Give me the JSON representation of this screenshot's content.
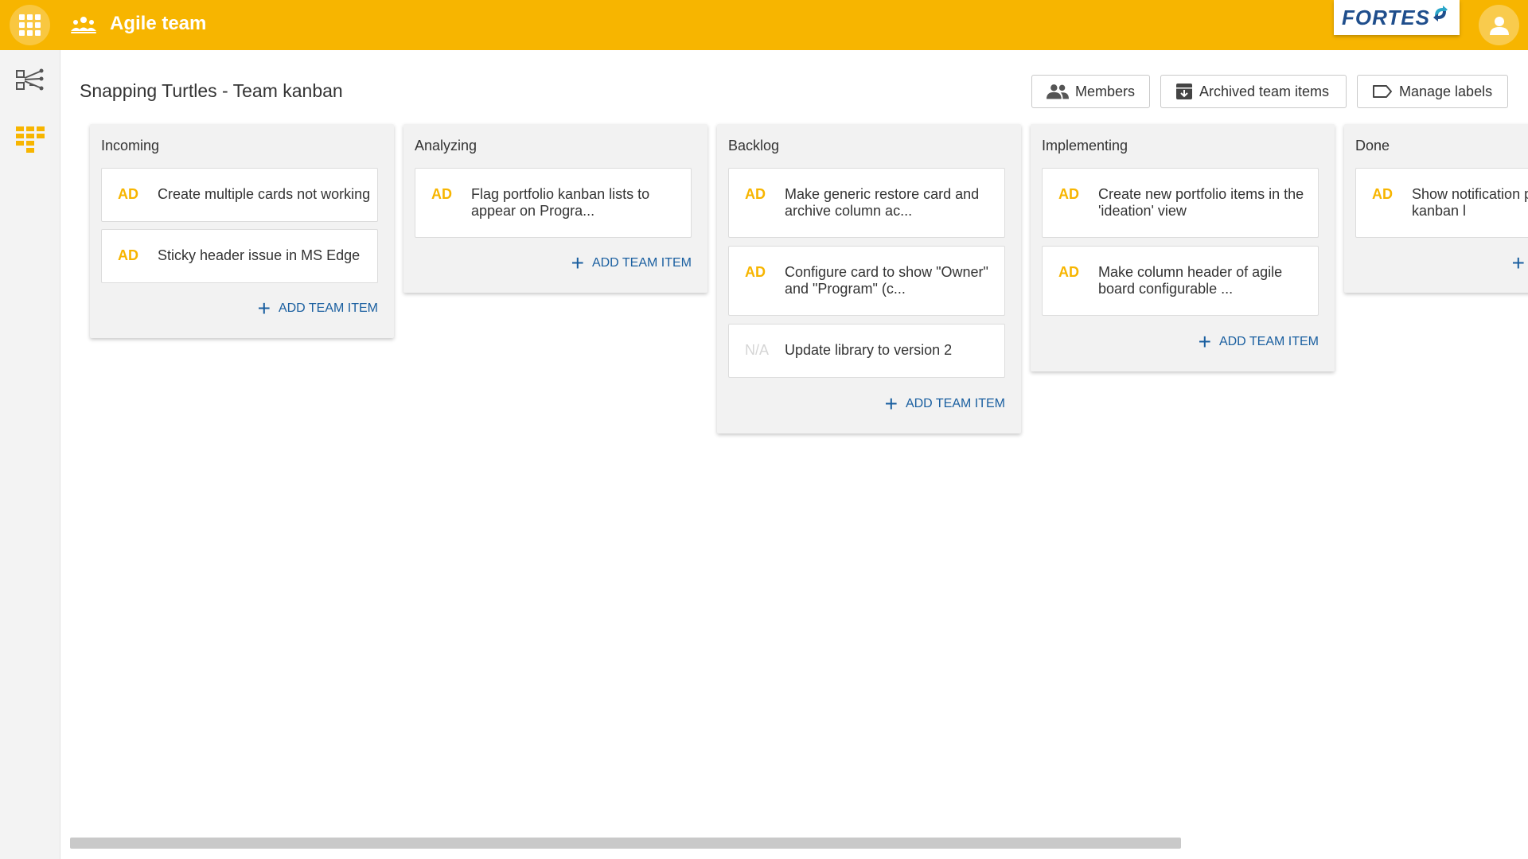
{
  "topbar": {
    "app_title": "Agile team",
    "logo_text": "FORTES",
    "accent_color": "#f7b500",
    "icons": [
      "apps-grid-icon",
      "team-icon",
      "user-icon"
    ]
  },
  "sidebar": {
    "items": [
      {
        "name": "hierarchy-icon",
        "active": false
      },
      {
        "name": "kanban-board-icon",
        "active": true
      }
    ]
  },
  "header": {
    "page_title": "Snapping Turtles - Team kanban",
    "buttons": {
      "members": "Members",
      "archived": "Archived team items",
      "labels": "Manage labels"
    }
  },
  "board": {
    "add_label": "ADD TEAM ITEM",
    "columns": [
      {
        "title": "Incoming",
        "cards": [
          {
            "tag": "AD",
            "text": "Create multiple cards not working"
          },
          {
            "tag": "AD",
            "text": "Sticky header issue in MS Edge"
          }
        ]
      },
      {
        "title": "Analyzing",
        "cards": [
          {
            "tag": "AD",
            "text": "Flag portfolio kanban lists to appear on Progra..."
          }
        ]
      },
      {
        "title": "Backlog",
        "cards": [
          {
            "tag": "AD",
            "text": "Make generic restore card and archive column ac..."
          },
          {
            "tag": "AD",
            "text": "Configure card to show \"Owner\" and \"Program\" (c..."
          },
          {
            "tag": "N/A",
            "text": "Update library to version 2"
          }
        ]
      },
      {
        "title": "Implementing",
        "cards": [
          {
            "tag": "AD",
            "text": "Create new portfolio items in the 'ideation' view"
          },
          {
            "tag": "AD",
            "text": "Make column header of agile board configurable ..."
          }
        ]
      },
      {
        "title": "Done",
        "cards": [
          {
            "tag": "AD",
            "text": "Show notification program kanban l"
          }
        ]
      }
    ]
  }
}
